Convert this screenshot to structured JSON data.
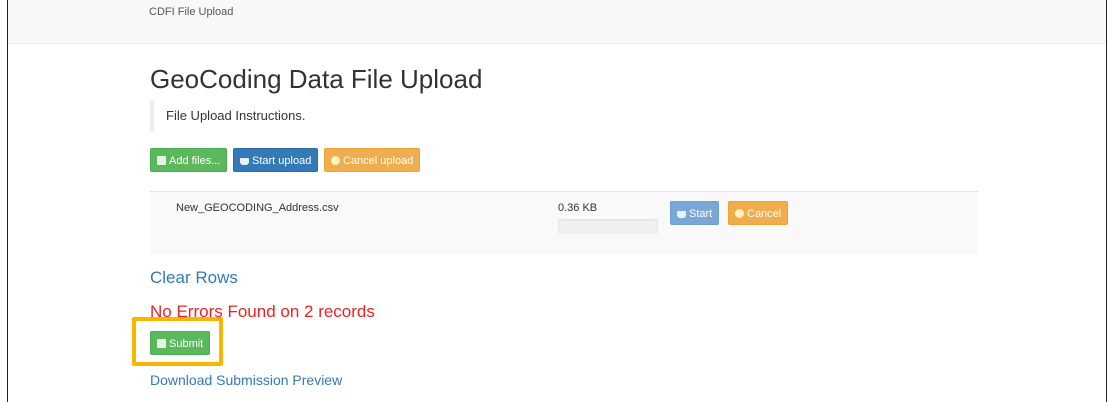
{
  "header": {
    "brand": "CDFI File Upload"
  },
  "page": {
    "title": "GeoCoding Data File Upload",
    "instructions": "File Upload Instructions."
  },
  "toolbar": {
    "add_files_label": "Add files...",
    "start_upload_label": "Start upload",
    "cancel_upload_label": "Cancel upload"
  },
  "files": [
    {
      "name": "New_GEOCODING_Address.csv",
      "size": "0.36 KB",
      "progress": 0,
      "start_label": "Start",
      "cancel_label": "Cancel"
    }
  ],
  "clear_rows_label": "Clear Rows",
  "status_message": "No Errors Found on 2 records",
  "submit_label": "Submit",
  "download_preview_label": "Download Submission Preview",
  "colors": {
    "success": "#5cb85c",
    "primary": "#337ab7",
    "warning": "#f0ad4e",
    "error_text": "#ee2222",
    "highlight": "#f7b600"
  },
  "icons": {
    "add_files": "file-icon",
    "start_upload": "upload-icon",
    "cancel_upload": "ban-icon",
    "submit": "file-icon"
  }
}
